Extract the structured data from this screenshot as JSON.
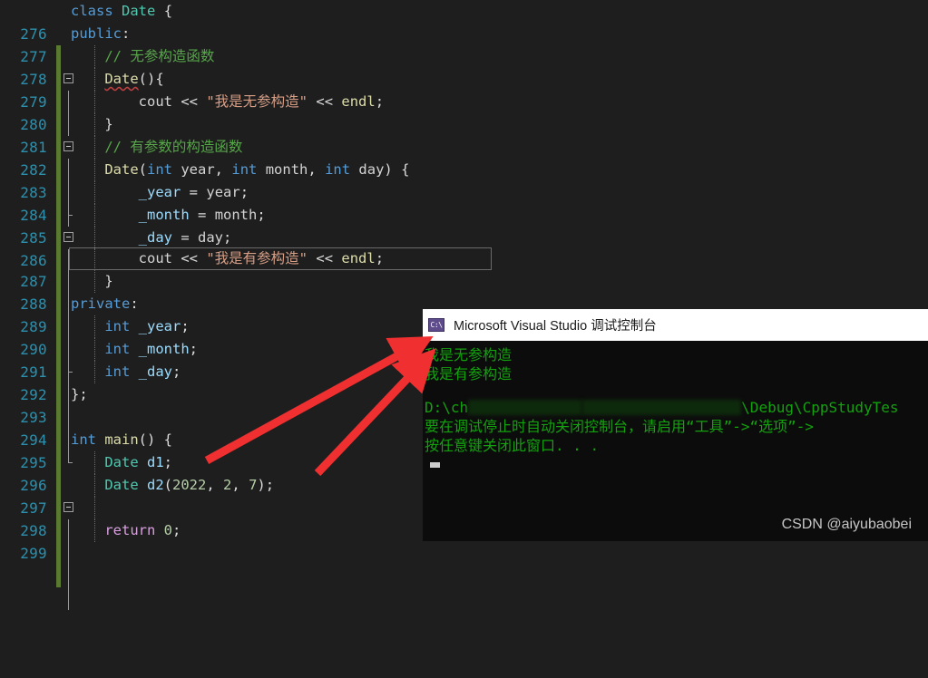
{
  "editor": {
    "background": "#1e1e1e",
    "line_number_color": "#2b91af",
    "changed_bar_color": "#5a7a31",
    "first_line_number": 276,
    "lines": [
      {
        "num": "276",
        "indent": 0,
        "text": "class Date {"
      },
      {
        "num": "277",
        "indent": 0,
        "text": "public:"
      },
      {
        "num": "278",
        "indent": 1,
        "text": "// 无参构造函数"
      },
      {
        "num": "279",
        "indent": 1,
        "text": "Date(){"
      },
      {
        "num": "280",
        "indent": 2,
        "text": "cout << \"我是无参构造\" << endl;"
      },
      {
        "num": "281",
        "indent": 1,
        "text": "}"
      },
      {
        "num": "282",
        "indent": 1,
        "text": "// 有参数的构造函数"
      },
      {
        "num": "283",
        "indent": 1,
        "text": "Date(int year, int month, int day) {"
      },
      {
        "num": "284",
        "indent": 2,
        "text": "_year = year;"
      },
      {
        "num": "285",
        "indent": 2,
        "text": "_month = month;"
      },
      {
        "num": "286",
        "indent": 2,
        "text": "_day = day;"
      },
      {
        "num": "287",
        "indent": 2,
        "text": "cout << \"我是有参构造\" << endl;"
      },
      {
        "num": "288",
        "indent": 1,
        "text": "}"
      },
      {
        "num": "289",
        "indent": 0,
        "text": "private:"
      },
      {
        "num": "290",
        "indent": 1,
        "text": "int _year;"
      },
      {
        "num": "291",
        "indent": 1,
        "text": "int _month;"
      },
      {
        "num": "292",
        "indent": 1,
        "text": "int _day;"
      },
      {
        "num": "293",
        "indent": 0,
        "text": "};"
      },
      {
        "num": "294",
        "indent": 0,
        "text": ""
      },
      {
        "num": "295",
        "indent": 0,
        "text": "int main() {"
      },
      {
        "num": "296",
        "indent": 1,
        "text": "Date d1;"
      },
      {
        "num": "297",
        "indent": 1,
        "text": "Date d2(2022, 2, 7);"
      },
      {
        "num": "298",
        "indent": 1,
        "text": ""
      },
      {
        "num": "299",
        "indent": 1,
        "text": "return 0;"
      }
    ],
    "highlighted_line": "287"
  },
  "console": {
    "title": "Microsoft Visual Studio 调试控制台",
    "icon": "console-icon",
    "icon_glyph": "C:\\",
    "titlebar_color": "#ffffff",
    "background": "#0c0c0c",
    "text_color": "#13a10e",
    "output_lines": [
      "我是无参构造",
      "我是有参构造"
    ],
    "path_line_prefix": "D:\\ch",
    "path_line_suffix": "\\Debug\\CppStudyTes",
    "hint_line": "要在调试停止时自动关闭控制台，请启用“工具”->“选项”->",
    "close_line": "按任意键关闭此窗口. . ."
  },
  "annotations": {
    "arrow_color": "#f03030",
    "arrows": [
      {
        "name": "arrow-to-first-output",
        "from_label": "Date d1;",
        "to_label": "我是无参构造"
      },
      {
        "name": "arrow-to-second-output",
        "from_label": "Date d2(2022, 2, 7);",
        "to_label": "我是有参构造"
      }
    ]
  },
  "watermark": {
    "text": "CSDN @aiyubaobei"
  }
}
